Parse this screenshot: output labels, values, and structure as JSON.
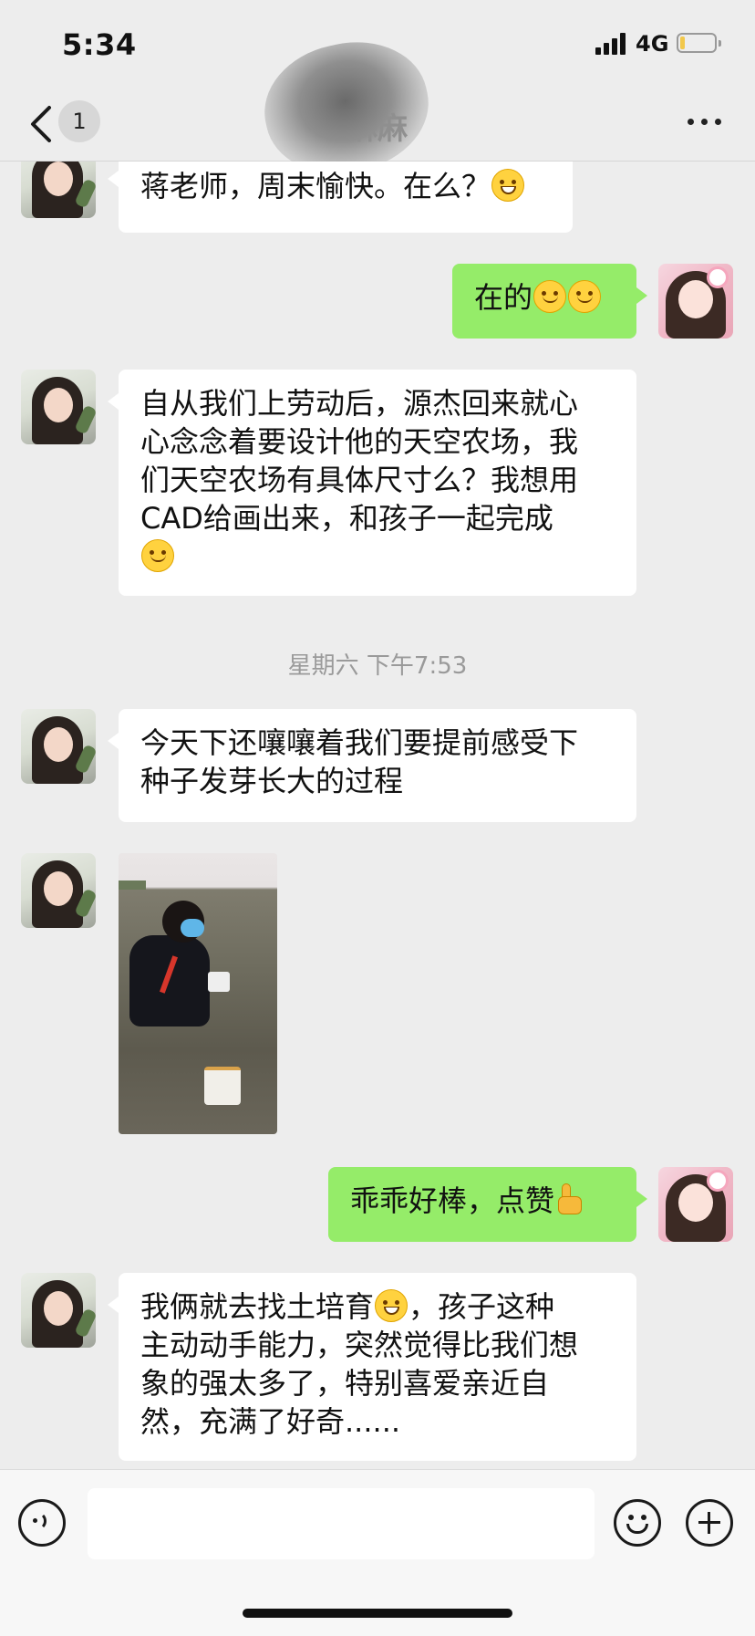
{
  "status_bar": {
    "time": "5:34",
    "network": "4G"
  },
  "nav": {
    "unread_count": "1",
    "title": "麻麻"
  },
  "messages": [
    {
      "from": "contact",
      "text": "蒋老师，周末愉快。在么？",
      "emoji": "grin"
    },
    {
      "from": "me",
      "text": "在的",
      "emoji": "smile x2"
    },
    {
      "from": "contact",
      "text": "自从我们上劳动后，源杰回来就心心念念着要设计他的天空农场，我们天空农场有具体尺寸么？我想用CAD给画出来，和孩子一起完成",
      "emoji": "smile"
    },
    {
      "from": "contact",
      "text": "今天下还嚷嚷着我们要提前感受下种子发芽长大的过程"
    },
    {
      "from": "contact",
      "type": "image",
      "description_icon": "photo"
    },
    {
      "from": "me",
      "text": "乖乖好棒，点赞",
      "emoji": "thumbs-up"
    },
    {
      "from": "contact",
      "text_before": "我俩就去找土培育",
      "emoji": "grin",
      "text_after": "，孩子这种主动动手能力，突然觉得比我们想象的强太多了，特别喜爱亲近自然，充满了好奇......"
    }
  ],
  "timestamp": "星期六 下午7:53",
  "msg1": {
    "text": "蒋老师，周末愉快。在么？"
  },
  "msg2": {
    "text": "在的"
  },
  "msg3": {
    "line1": "自从我们上劳动后，源杰回来就心",
    "line2": "心念念着要设计他的天空农场，我",
    "line3": "们天空农场有具体尺寸么？我想用",
    "line4": "CAD给画出来，和孩子一起完成"
  },
  "msg4": {
    "line1": "今天下还嚷嚷着我们要提前感受下",
    "line2": "种子发芽长大的过程"
  },
  "msg6": {
    "text": "乖乖好棒，点赞"
  },
  "msg7": {
    "line1a": "我俩就去找土培育",
    "line1b": "，孩子这种",
    "line2": "主动动手能力，突然觉得比我们想",
    "line3": "象的强太多了，特别喜爱亲近自",
    "line4": "然，充满了好奇......"
  },
  "colors": {
    "background": "#ededed",
    "outgoing_bubble": "#95ec69",
    "incoming_bubble": "#ffffff"
  }
}
